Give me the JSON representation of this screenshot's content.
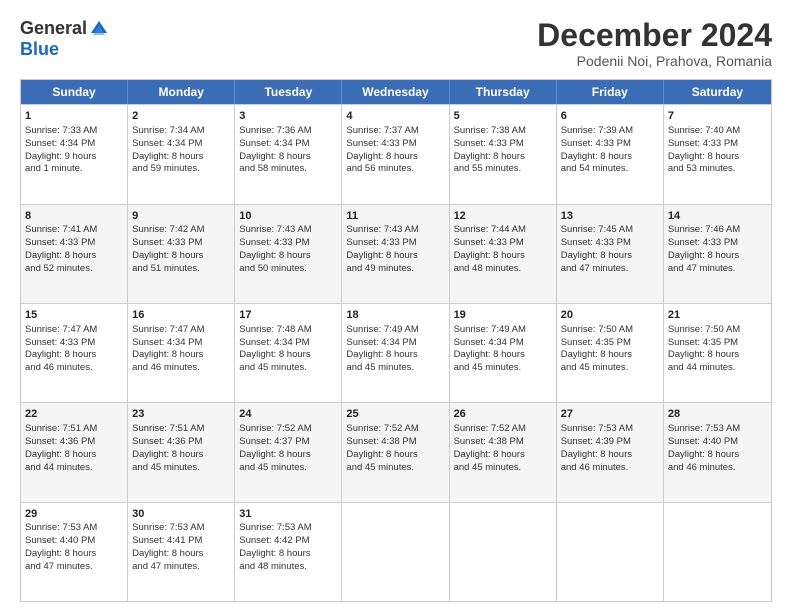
{
  "logo": {
    "general": "General",
    "blue": "Blue"
  },
  "title": "December 2024",
  "subtitle": "Podenii Noi, Prahova, Romania",
  "weekdays": [
    "Sunday",
    "Monday",
    "Tuesday",
    "Wednesday",
    "Thursday",
    "Friday",
    "Saturday"
  ],
  "rows": [
    [
      {
        "day": "1",
        "lines": [
          "Sunrise: 7:33 AM",
          "Sunset: 4:34 PM",
          "Daylight: 9 hours",
          "and 1 minute."
        ]
      },
      {
        "day": "2",
        "lines": [
          "Sunrise: 7:34 AM",
          "Sunset: 4:34 PM",
          "Daylight: 8 hours",
          "and 59 minutes."
        ]
      },
      {
        "day": "3",
        "lines": [
          "Sunrise: 7:36 AM",
          "Sunset: 4:34 PM",
          "Daylight: 8 hours",
          "and 58 minutes."
        ]
      },
      {
        "day": "4",
        "lines": [
          "Sunrise: 7:37 AM",
          "Sunset: 4:33 PM",
          "Daylight: 8 hours",
          "and 56 minutes."
        ]
      },
      {
        "day": "5",
        "lines": [
          "Sunrise: 7:38 AM",
          "Sunset: 4:33 PM",
          "Daylight: 8 hours",
          "and 55 minutes."
        ]
      },
      {
        "day": "6",
        "lines": [
          "Sunrise: 7:39 AM",
          "Sunset: 4:33 PM",
          "Daylight: 8 hours",
          "and 54 minutes."
        ]
      },
      {
        "day": "7",
        "lines": [
          "Sunrise: 7:40 AM",
          "Sunset: 4:33 PM",
          "Daylight: 8 hours",
          "and 53 minutes."
        ]
      }
    ],
    [
      {
        "day": "8",
        "lines": [
          "Sunrise: 7:41 AM",
          "Sunset: 4:33 PM",
          "Daylight: 8 hours",
          "and 52 minutes."
        ]
      },
      {
        "day": "9",
        "lines": [
          "Sunrise: 7:42 AM",
          "Sunset: 4:33 PM",
          "Daylight: 8 hours",
          "and 51 minutes."
        ]
      },
      {
        "day": "10",
        "lines": [
          "Sunrise: 7:43 AM",
          "Sunset: 4:33 PM",
          "Daylight: 8 hours",
          "and 50 minutes."
        ]
      },
      {
        "day": "11",
        "lines": [
          "Sunrise: 7:43 AM",
          "Sunset: 4:33 PM",
          "Daylight: 8 hours",
          "and 49 minutes."
        ]
      },
      {
        "day": "12",
        "lines": [
          "Sunrise: 7:44 AM",
          "Sunset: 4:33 PM",
          "Daylight: 8 hours",
          "and 48 minutes."
        ]
      },
      {
        "day": "13",
        "lines": [
          "Sunrise: 7:45 AM",
          "Sunset: 4:33 PM",
          "Daylight: 8 hours",
          "and 47 minutes."
        ]
      },
      {
        "day": "14",
        "lines": [
          "Sunrise: 7:46 AM",
          "Sunset: 4:33 PM",
          "Daylight: 8 hours",
          "and 47 minutes."
        ]
      }
    ],
    [
      {
        "day": "15",
        "lines": [
          "Sunrise: 7:47 AM",
          "Sunset: 4:33 PM",
          "Daylight: 8 hours",
          "and 46 minutes."
        ]
      },
      {
        "day": "16",
        "lines": [
          "Sunrise: 7:47 AM",
          "Sunset: 4:34 PM",
          "Daylight: 8 hours",
          "and 46 minutes."
        ]
      },
      {
        "day": "17",
        "lines": [
          "Sunrise: 7:48 AM",
          "Sunset: 4:34 PM",
          "Daylight: 8 hours",
          "and 45 minutes."
        ]
      },
      {
        "day": "18",
        "lines": [
          "Sunrise: 7:49 AM",
          "Sunset: 4:34 PM",
          "Daylight: 8 hours",
          "and 45 minutes."
        ]
      },
      {
        "day": "19",
        "lines": [
          "Sunrise: 7:49 AM",
          "Sunset: 4:34 PM",
          "Daylight: 8 hours",
          "and 45 minutes."
        ]
      },
      {
        "day": "20",
        "lines": [
          "Sunrise: 7:50 AM",
          "Sunset: 4:35 PM",
          "Daylight: 8 hours",
          "and 45 minutes."
        ]
      },
      {
        "day": "21",
        "lines": [
          "Sunrise: 7:50 AM",
          "Sunset: 4:35 PM",
          "Daylight: 8 hours",
          "and 44 minutes."
        ]
      }
    ],
    [
      {
        "day": "22",
        "lines": [
          "Sunrise: 7:51 AM",
          "Sunset: 4:36 PM",
          "Daylight: 8 hours",
          "and 44 minutes."
        ]
      },
      {
        "day": "23",
        "lines": [
          "Sunrise: 7:51 AM",
          "Sunset: 4:36 PM",
          "Daylight: 8 hours",
          "and 45 minutes."
        ]
      },
      {
        "day": "24",
        "lines": [
          "Sunrise: 7:52 AM",
          "Sunset: 4:37 PM",
          "Daylight: 8 hours",
          "and 45 minutes."
        ]
      },
      {
        "day": "25",
        "lines": [
          "Sunrise: 7:52 AM",
          "Sunset: 4:38 PM",
          "Daylight: 8 hours",
          "and 45 minutes."
        ]
      },
      {
        "day": "26",
        "lines": [
          "Sunrise: 7:52 AM",
          "Sunset: 4:38 PM",
          "Daylight: 8 hours",
          "and 45 minutes."
        ]
      },
      {
        "day": "27",
        "lines": [
          "Sunrise: 7:53 AM",
          "Sunset: 4:39 PM",
          "Daylight: 8 hours",
          "and 46 minutes."
        ]
      },
      {
        "day": "28",
        "lines": [
          "Sunrise: 7:53 AM",
          "Sunset: 4:40 PM",
          "Daylight: 8 hours",
          "and 46 minutes."
        ]
      }
    ],
    [
      {
        "day": "29",
        "lines": [
          "Sunrise: 7:53 AM",
          "Sunset: 4:40 PM",
          "Daylight: 8 hours",
          "and 47 minutes."
        ]
      },
      {
        "day": "30",
        "lines": [
          "Sunrise: 7:53 AM",
          "Sunset: 4:41 PM",
          "Daylight: 8 hours",
          "and 47 minutes."
        ]
      },
      {
        "day": "31",
        "lines": [
          "Sunrise: 7:53 AM",
          "Sunset: 4:42 PM",
          "Daylight: 8 hours",
          "and 48 minutes."
        ]
      },
      {
        "day": "",
        "lines": []
      },
      {
        "day": "",
        "lines": []
      },
      {
        "day": "",
        "lines": []
      },
      {
        "day": "",
        "lines": []
      }
    ]
  ]
}
